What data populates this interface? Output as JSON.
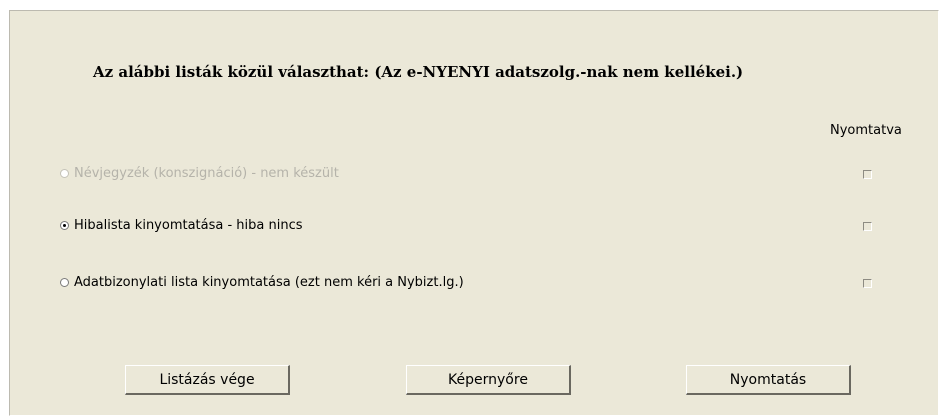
{
  "heading": "Az alábbi listák közül választhat: (Az e-NYENYI adatszolg.-nak nem kellékei.)",
  "print_column_header": "Nyomtatva",
  "options": [
    {
      "label": "Névjegyzék (konszignáció) - nem készült",
      "selected": false,
      "enabled": false,
      "printed": false
    },
    {
      "label": "Hibalista kinyomtatása - hiba nincs",
      "selected": true,
      "enabled": true,
      "printed": false
    },
    {
      "label": "Adatbizonylati lista kinyomtatása (ezt nem kéri a Nybizt.lg.)",
      "selected": false,
      "enabled": true,
      "printed": false
    }
  ],
  "buttons": {
    "end_listing": "Listázás vége",
    "to_screen": "Képernyőre",
    "print": "Nyomtatás"
  },
  "colors": {
    "background": "#ebe8d8",
    "disabled_text": "#b5b3aa"
  }
}
